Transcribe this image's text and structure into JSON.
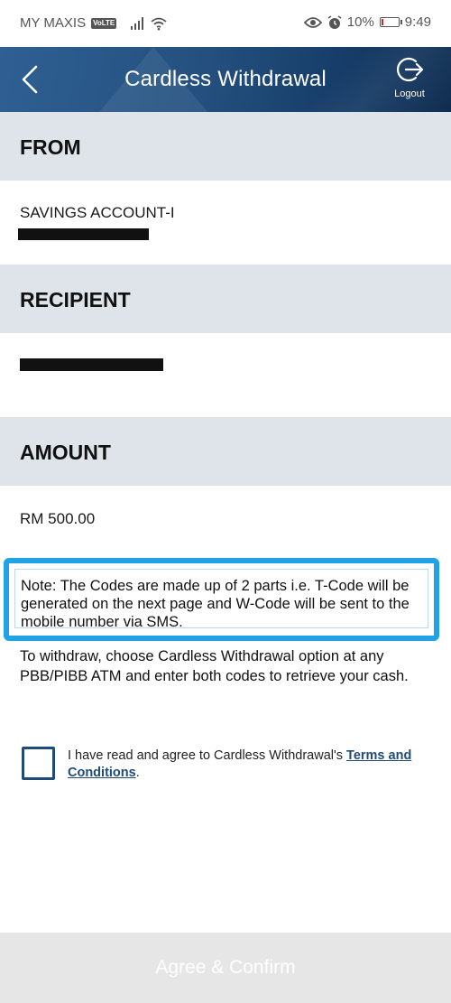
{
  "status_bar": {
    "carrier": "MY MAXIS",
    "volte": "VoLTE",
    "battery": "10%",
    "battery_level": 0.1,
    "time": "9:49"
  },
  "header": {
    "title": "Cardless Withdrawal",
    "logout_label": "Logout"
  },
  "sections": {
    "from_title": "FROM",
    "from_account": "SAVINGS ACCOUNT-I",
    "recipient_title": "RECIPIENT",
    "amount_title": "AMOUNT",
    "amount_value": "RM 500.00"
  },
  "note": "Note: The Codes are made up of 2 parts i.e. T-Code will be generated on the next page and W-Code will be sent to the mobile number via SMS.",
  "instruction": "To withdraw, choose Cardless Withdrawal option at any PBB/PIBB ATM and enter both codes to retrieve your cash.",
  "agreement": {
    "text": "I have read and agree to Cardless Withdrawal's ",
    "link": "Terms and Conditions",
    "suffix": "."
  },
  "confirm_label": "Agree & Confirm",
  "colors": {
    "header_bg": "#24507f",
    "section_bg": "#dfe4ea",
    "highlight_border": "#1fa3e6",
    "link": "#1f4b7a",
    "button_bg": "#e6e6e6"
  }
}
